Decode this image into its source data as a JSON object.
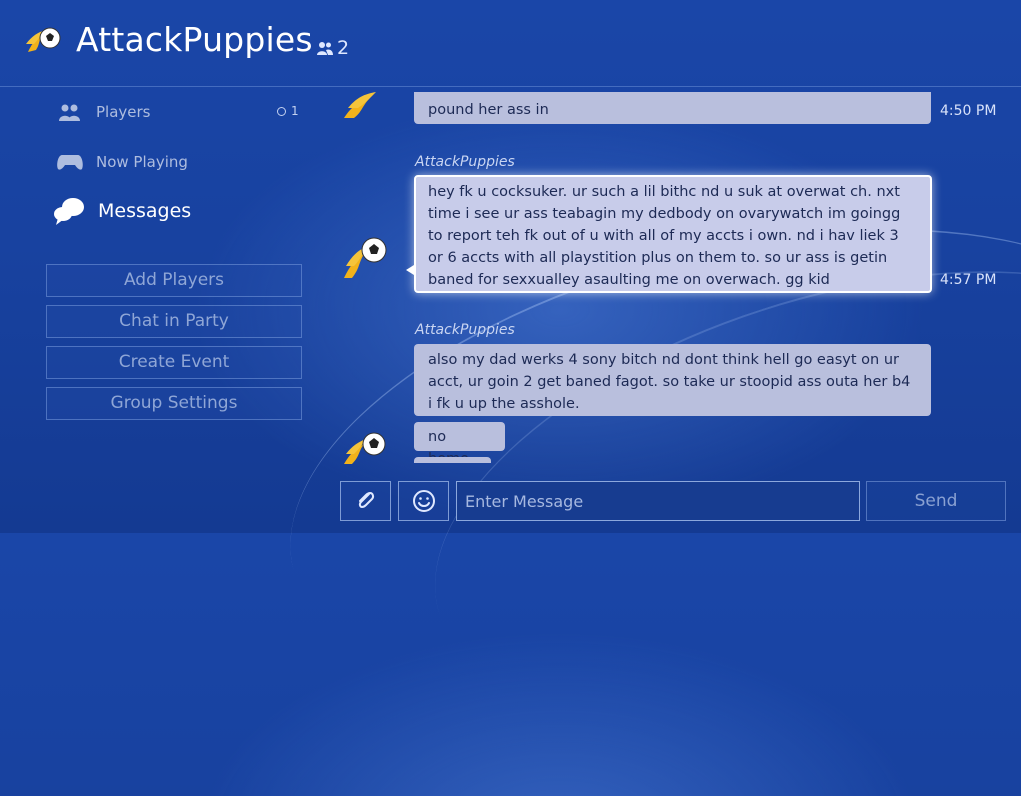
{
  "header": {
    "title": "AttackPuppies",
    "member_count": "2",
    "logo_icon": "flaming-soccer-ball-icon"
  },
  "sidebar": {
    "nav": [
      {
        "label": "Players",
        "badge": "1",
        "icon": "players-icon"
      },
      {
        "label": "Now Playing",
        "icon": "controller-icon"
      },
      {
        "label": "Messages",
        "icon": "speech-bubbles-icon",
        "active": true
      }
    ],
    "actions": [
      "Add Players",
      "Chat in Party",
      "Create Event",
      "Group Settings"
    ]
  },
  "messages": [
    {
      "sender": "",
      "text": "pound her ass in",
      "time": "4:50 PM"
    },
    {
      "sender": "AttackPuppies",
      "text": "hey fk u cocksuker. ur such a lil bithc nd u suk at overwat ch. nxt time i see ur ass teabagin my dedbody on ovarywatch im goingg to report teh fk out of u with all of my accts i own. nd i hav liek 3 or 6 accts with all playstition plus on them to. so ur ass is getin baned for sexxualley asaulting me on overwach. gg kid",
      "time": "4:57 PM",
      "selected": true
    },
    {
      "sender": "AttackPuppies",
      "text": "also my dad werks 4 sony bitch nd dont think hell go easyt on ur acct, ur goin 2 get baned fagot. so take ur stoopid ass outa her b4 i fk u up the asshole.",
      "time": ""
    },
    {
      "sender": "",
      "text": "no homo",
      "time": ""
    }
  ],
  "composer": {
    "placeholder": "Enter Message",
    "send_label": "Send",
    "attach_icon": "paperclip-icon",
    "emoji_icon": "smiley-face-icon"
  },
  "colors": {
    "background": "#1a46a8",
    "bubble": "#b9bfdd",
    "bubble_text": "#1d2a55"
  }
}
